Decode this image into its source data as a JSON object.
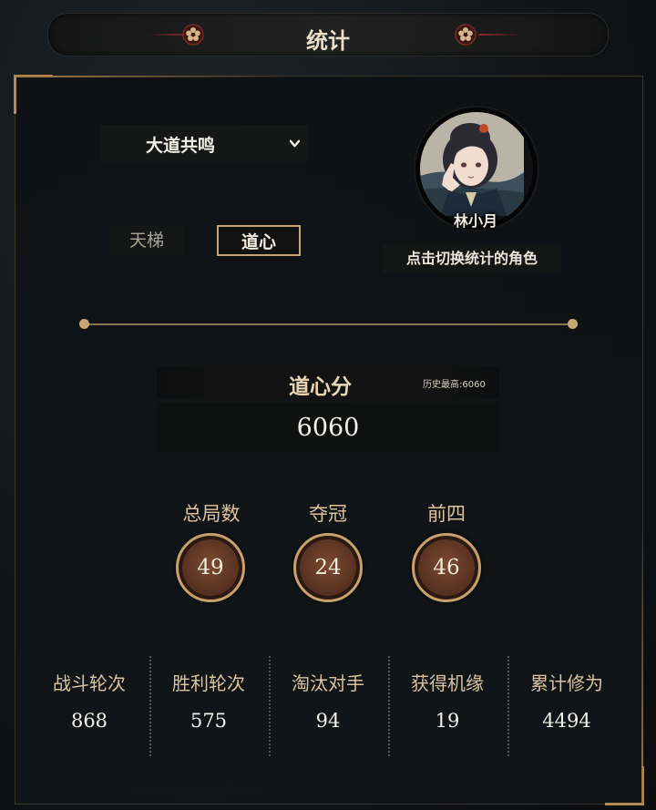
{
  "header": {
    "title": "统计"
  },
  "selector": {
    "mode_label": "大道共鸣"
  },
  "tabs": [
    {
      "label": "天梯",
      "active": false
    },
    {
      "label": "道心",
      "active": true
    }
  ],
  "character": {
    "name": "林小月",
    "switch_hint": "点击切换统计的角色"
  },
  "score": {
    "title": "道心分",
    "best_label": "历史最高:6060",
    "value": "6060"
  },
  "medals": [
    {
      "label": "总局数",
      "value": "49"
    },
    {
      "label": "夺冠",
      "value": "24"
    },
    {
      "label": "前四",
      "value": "46"
    }
  ],
  "stats": [
    {
      "label": "战斗轮次",
      "value": "868"
    },
    {
      "label": "胜利轮次",
      "value": "575"
    },
    {
      "label": "淘汰对手",
      "value": "94"
    },
    {
      "label": "获得机缘",
      "value": "19"
    },
    {
      "label": "累计修为",
      "value": "4494"
    }
  ],
  "colors": {
    "accent_gold": "#c6a56f",
    "medal_brown": "#5a3323",
    "background": "#111518"
  }
}
